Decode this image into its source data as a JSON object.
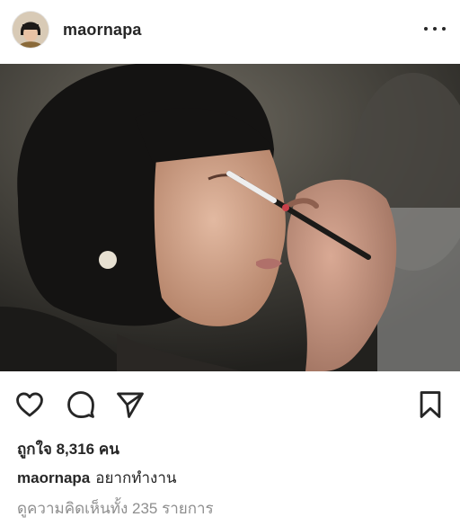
{
  "post": {
    "username": "maornapa",
    "more_icon": "more-horizontal-icon",
    "likes_text": "ถูกใจ 8,316 คน",
    "caption_user": "maornapa",
    "caption_text": "อยากทำงาน",
    "view_comments": "ดูความคิดเห็นทั้ง 235 รายการ"
  },
  "icons": {
    "like": "heart-icon",
    "comment": "comment-bubble-icon",
    "share": "paper-plane-icon",
    "save": "bookmark-icon"
  },
  "colors": {
    "text": "#262626",
    "muted": "#8e8e8e"
  }
}
